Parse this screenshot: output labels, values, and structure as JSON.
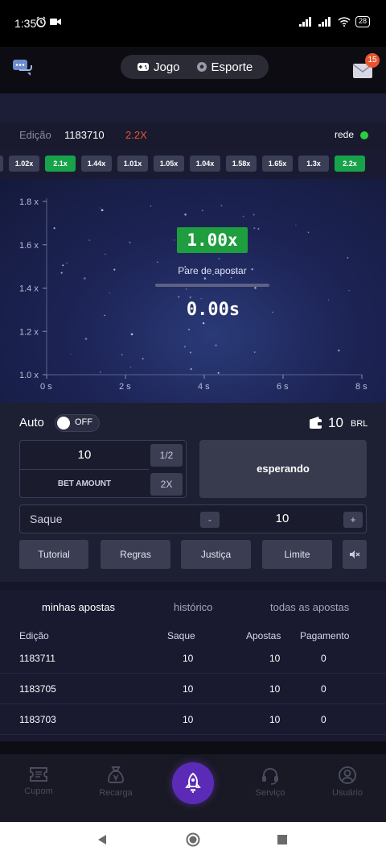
{
  "status_bar": {
    "time": "1:35",
    "battery": "28"
  },
  "top_nav": {
    "segment": [
      {
        "label": "Jogo",
        "active": true
      },
      {
        "label": "Esporte",
        "active": false
      }
    ],
    "mail_badge": "15"
  },
  "edition_bar": {
    "label": "Edição",
    "number": "1183710",
    "multiplier": "2.2X",
    "network_label": "rede",
    "network_color": "#2ecc40"
  },
  "history": [
    {
      "value": "1.02x",
      "color": "gray"
    },
    {
      "value": "2.1x",
      "color": "green"
    },
    {
      "value": "1.44x",
      "color": "gray"
    },
    {
      "value": "1.01x",
      "color": "gray"
    },
    {
      "value": "1.05x",
      "color": "gray"
    },
    {
      "value": "1.04x",
      "color": "gray"
    },
    {
      "value": "1.58x",
      "color": "gray"
    },
    {
      "value": "1.65x",
      "color": "gray"
    },
    {
      "value": "1.3x",
      "color": "gray"
    },
    {
      "value": "2.2x",
      "color": "green"
    }
  ],
  "chart_data": {
    "type": "line",
    "y_ticks": [
      "1.8 x",
      "1.6 x",
      "1.4 x",
      "1.2 x",
      "1.0 x"
    ],
    "x_ticks": [
      "0 s",
      "2 s",
      "4 s",
      "6 s",
      "8 s"
    ],
    "xlim": [
      0,
      8
    ],
    "ylim": [
      1.0,
      1.8
    ],
    "series": []
  },
  "game": {
    "multiplier": "1.00x",
    "status_text": "Pare de apostar",
    "timer": "0.00s"
  },
  "controls": {
    "auto_label": "Auto",
    "toggle_label": "OFF",
    "balance": "10",
    "currency": "BRL",
    "bet_value": "10",
    "bet_label": "BET AMOUNT",
    "half_label": "1/2",
    "double_label": "2X",
    "wait_label": "esperando",
    "saque_label": "Saque",
    "minus_label": "-",
    "saque_value": "10",
    "plus_label": "+",
    "buttons": [
      "Tutorial",
      "Regras",
      "Justiça",
      "Limite"
    ]
  },
  "bets": {
    "tabs": [
      "minhas apostas",
      "histórico",
      "todas as apostas"
    ],
    "columns": [
      "Edição",
      "Saque",
      "Apostas",
      "Pagamento"
    ],
    "rows": [
      [
        "1183711",
        "10",
        "10",
        "0"
      ],
      [
        "1183705",
        "10",
        "10",
        "0"
      ],
      [
        "1183703",
        "10",
        "10",
        "0"
      ]
    ]
  },
  "tab_bar": {
    "items": [
      {
        "label": "Cupom",
        "icon": "coupon-icon"
      },
      {
        "label": "Recarga",
        "icon": "moneybag-icon"
      },
      {
        "label": "",
        "icon": "rocket-icon"
      },
      {
        "label": "Serviço",
        "icon": "headset-icon"
      },
      {
        "label": "Usuário",
        "icon": "user-icon"
      }
    ]
  }
}
